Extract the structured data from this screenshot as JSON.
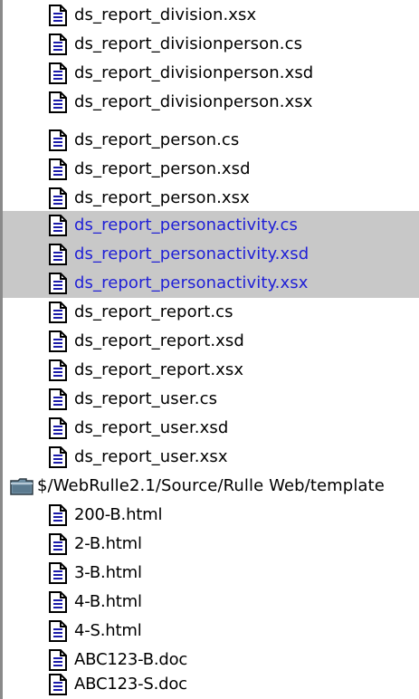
{
  "tree": {
    "items": [
      {
        "type": "file",
        "label": "ds_report_division.xsx",
        "selected": false
      },
      {
        "type": "file",
        "label": "ds_report_divisionperson.cs",
        "selected": false
      },
      {
        "type": "file",
        "label": "ds_report_divisionperson.xsd",
        "selected": false
      },
      {
        "type": "file",
        "label": "ds_report_divisionperson.xsx",
        "selected": false
      },
      {
        "type": "file",
        "label": "ds_report_person.cs",
        "selected": false
      },
      {
        "type": "file",
        "label": "ds_report_person.xsd",
        "selected": false
      },
      {
        "type": "file",
        "label": "ds_report_person.xsx",
        "selected": false
      },
      {
        "type": "file",
        "label": "ds_report_personactivity.cs",
        "selected": true
      },
      {
        "type": "file",
        "label": "ds_report_personactivity.xsd",
        "selected": true
      },
      {
        "type": "file",
        "label": "ds_report_personactivity.xsx",
        "selected": true
      },
      {
        "type": "file",
        "label": "ds_report_report.cs",
        "selected": false
      },
      {
        "type": "file",
        "label": "ds_report_report.xsd",
        "selected": false
      },
      {
        "type": "file",
        "label": "ds_report_report.xsx",
        "selected": false
      },
      {
        "type": "file",
        "label": "ds_report_user.cs",
        "selected": false
      },
      {
        "type": "file",
        "label": "ds_report_user.xsd",
        "selected": false
      },
      {
        "type": "file",
        "label": "ds_report_user.xsx",
        "selected": false
      },
      {
        "type": "folder",
        "label": "$/WebRulle2.1/Source/Rulle Web/template",
        "selected": false
      },
      {
        "type": "file",
        "label": "200-B.html",
        "selected": false
      },
      {
        "type": "file",
        "label": "2-B.html",
        "selected": false
      },
      {
        "type": "file",
        "label": "3-B.html",
        "selected": false
      },
      {
        "type": "file",
        "label": "4-B.html",
        "selected": false
      },
      {
        "type": "file",
        "label": "4-S.html",
        "selected": false
      },
      {
        "type": "file",
        "label": "ABC123-B.doc",
        "selected": false
      },
      {
        "type": "file",
        "label": "ABC123-S.doc",
        "selected": false
      }
    ]
  },
  "colors": {
    "selected_background": "#c8c8c8",
    "selected_text": "#1f1fd6"
  },
  "icons": {
    "file": "document-icon",
    "folder": "folder-icon"
  }
}
